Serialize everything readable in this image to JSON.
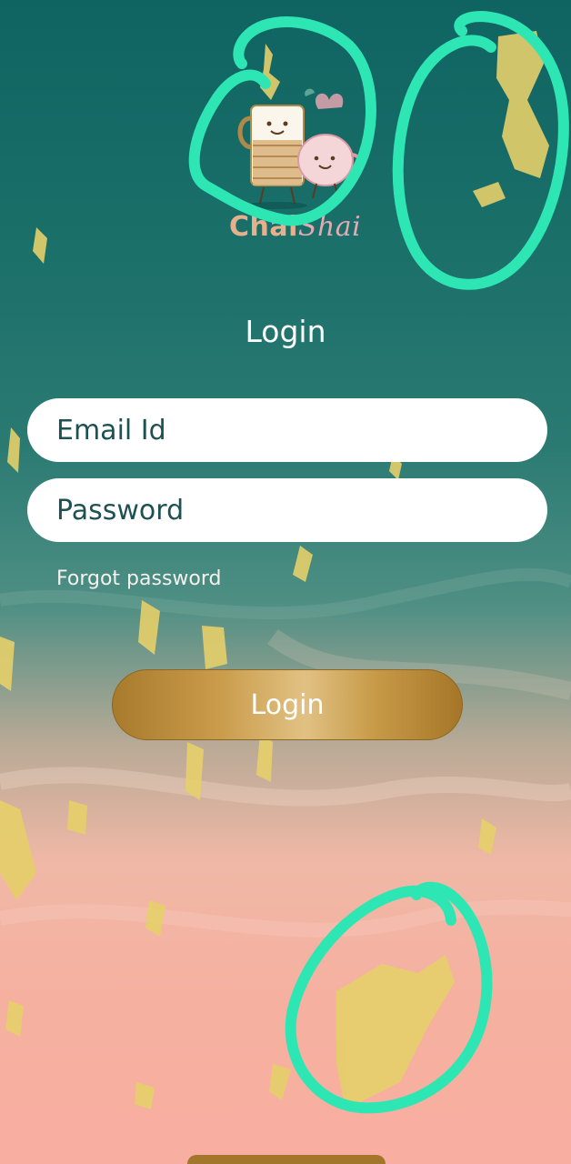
{
  "brand": {
    "name_part1": "Chai",
    "name_part2": "Shai"
  },
  "login": {
    "title": "Login",
    "email_placeholder": "Email Id",
    "password_placeholder": "Password",
    "forgot_label": "Forgot password",
    "button_label": "Login"
  },
  "colors": {
    "teal_top": "#0f6462",
    "peach_bottom": "#f8aea0",
    "gold_button": "#c99b4a",
    "annotation_stroke": "#2ee6b3",
    "input_text": "#1d5154"
  },
  "icons": {
    "logo": "chai-cups-logo-icon"
  }
}
